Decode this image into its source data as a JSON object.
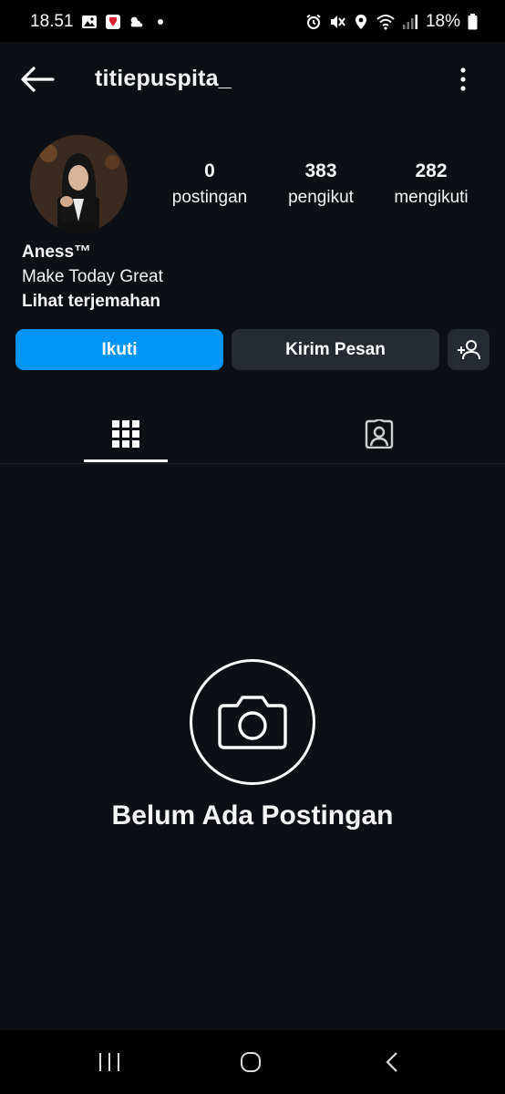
{
  "status_bar": {
    "time": "18.51",
    "battery": "18%",
    "icons": [
      "gallery-icon",
      "app-notification-icon",
      "weather-icon",
      "alarm-icon",
      "mute-icon",
      "location-icon",
      "wifi-icon",
      "signal-icon",
      "battery-icon"
    ]
  },
  "header": {
    "username": "titiepuspita_"
  },
  "profile": {
    "stats": [
      {
        "value": "0",
        "label": "postingan"
      },
      {
        "value": "383",
        "label": "pengikut"
      },
      {
        "value": "282",
        "label": "mengikuti"
      }
    ],
    "name": "Aness™",
    "bio": "Make Today Great",
    "translate_link": "Lihat terjemahan"
  },
  "actions": {
    "follow_label": "Ikuti",
    "message_label": "Kirim Pesan"
  },
  "tabs": [
    "grid-icon",
    "tagged-icon"
  ],
  "empty_state": {
    "title": "Belum Ada Postingan"
  },
  "colors": {
    "background": "#0c0f14",
    "accent": "#0095f6",
    "secondary_button": "#262a31"
  }
}
